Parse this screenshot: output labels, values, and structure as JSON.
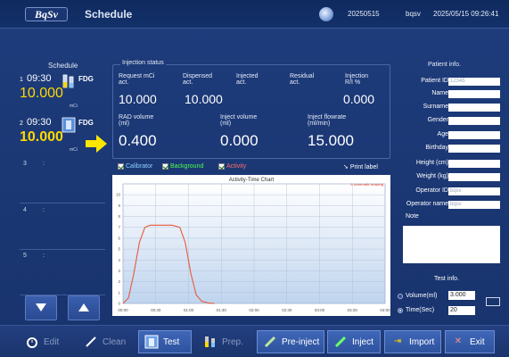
{
  "header": {
    "logo": "BqSv",
    "title": "Schedule",
    "date": "20250515",
    "user": "bqsv",
    "datetime": "2025/05/15 09:26:41"
  },
  "schedule": {
    "heading": "Schedule",
    "items": [
      {
        "num": "1",
        "time": "09:30",
        "isotope": "FDG",
        "activity": "10.000",
        "unit": "mCi"
      },
      {
        "num": "2",
        "time": "09:30",
        "isotope": "FDG",
        "activity": "10.000",
        "unit": "mCi"
      }
    ],
    "empty_slots": [
      {
        "num": "3",
        "colon": ":"
      },
      {
        "num": "4",
        "colon": ":"
      },
      {
        "num": "5",
        "colon": ":"
      }
    ]
  },
  "injection": {
    "heading": "Injection status",
    "request_label": "Request mCi\nact.",
    "dispensed_label": "Dispensed\nact.",
    "injected_label": "Injected\nact.",
    "residual_label": "Residual\nact.",
    "rinj_label": "Injection\nR/I %",
    "request": "10.000",
    "dispensed": "10.000",
    "rinj": "0.000",
    "rad_volume_label": "RAD volume\n(ml)",
    "inject_volume_label": "Inject volume\n(ml)",
    "inject_flowrate_label": "Inject flowrate\n(ml/min)",
    "rad_volume": "0.400",
    "inject_volume": "0.000",
    "inject_flowrate": "15.000"
  },
  "checkboxes": [
    {
      "label": "Calibrator",
      "color": "#8fd0ff"
    },
    {
      "label": "Background",
      "color": "#4cff4c"
    },
    {
      "label": "Activity",
      "color": "#ff6b6b"
    }
  ],
  "print_label": "Print label",
  "chart_data": {
    "type": "line",
    "title": "Activity-Time Chart",
    "annotation": "A schematic drawing",
    "xlabel": "",
    "ylabel": "",
    "x_ticks": [
      "00:00",
      "00:30",
      "01:00",
      "01:30",
      "02:00",
      "02:30",
      "03:00",
      "03:30",
      "04:00"
    ],
    "y_ticks": [
      0,
      1,
      2,
      3,
      4,
      5,
      6,
      7,
      8,
      9,
      10
    ],
    "xlim_sec": [
      0,
      240
    ],
    "ylim": [
      0,
      11
    ],
    "series": [
      {
        "color": "#e85a3a",
        "points": [
          [
            0,
            0
          ],
          [
            5,
            0.5
          ],
          [
            10,
            2.8
          ],
          [
            15,
            5.6
          ],
          [
            20,
            7.0
          ],
          [
            25,
            7.2
          ],
          [
            35,
            7.2
          ],
          [
            45,
            7.2
          ],
          [
            52,
            7.0
          ],
          [
            57,
            5.6
          ],
          [
            62,
            2.8
          ],
          [
            67,
            0.8
          ],
          [
            72,
            0.2
          ],
          [
            78,
            0.05
          ],
          [
            84,
            0
          ]
        ]
      }
    ],
    "grid": true
  },
  "patient": {
    "heading": "Patient info.",
    "fields": [
      {
        "label": "Patient ID",
        "value": "12345"
      },
      {
        "label": "Name",
        "value": ""
      },
      {
        "label": "Surname",
        "value": ""
      },
      {
        "label": "Gender",
        "value": ""
      },
      {
        "label": "Age",
        "value": ""
      },
      {
        "label": "Birthday",
        "value": ""
      },
      {
        "label": "Height (cm)",
        "value": ""
      },
      {
        "label": "Weight (kg)",
        "value": ""
      },
      {
        "label": "Operator ID",
        "value": "bqsv"
      },
      {
        "label": "Operator name",
        "value": "bqsv"
      }
    ],
    "note_label": "Note"
  },
  "test": {
    "heading": "Test info.",
    "volume_label": "Volume(ml)",
    "volume": "3.000",
    "time_label": "Time(Sec)",
    "time": "20"
  },
  "toolbar": {
    "edit": "Edit",
    "clean": "Clean",
    "test": "Test",
    "prep": "Prep.",
    "pre_inject": "Pre-inject",
    "inject": "Inject",
    "import": "Import",
    "exit": "Exit"
  }
}
